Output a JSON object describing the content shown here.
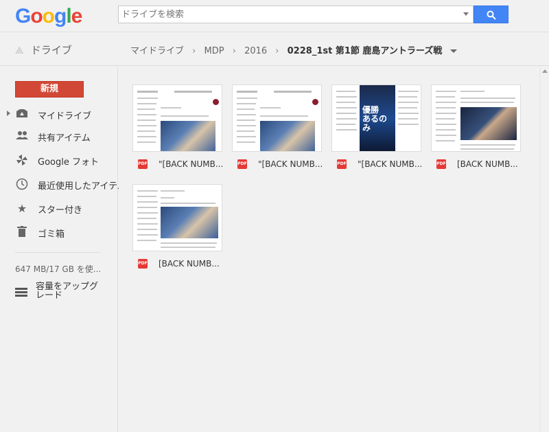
{
  "logo": {
    "letters": [
      {
        "ch": "G",
        "color": "#4285f4"
      },
      {
        "ch": "o",
        "color": "#ea4335"
      },
      {
        "ch": "o",
        "color": "#fbbc05"
      },
      {
        "ch": "g",
        "color": "#4285f4"
      },
      {
        "ch": "l",
        "color": "#34a853"
      },
      {
        "ch": "e",
        "color": "#ea4335"
      }
    ]
  },
  "search": {
    "placeholder": "ドライブを検索",
    "icon": "search-icon"
  },
  "app": {
    "title": "ドライブ",
    "icon": "drive-icon"
  },
  "breadcrumb": {
    "items": [
      "マイドライブ",
      "MDP",
      "2016"
    ],
    "current": "0228_1st 第1節 鹿島アントラーズ戦"
  },
  "sidebar": {
    "new_label": "新規",
    "items": [
      {
        "label": "マイドライブ",
        "icon": "my-drive-icon"
      },
      {
        "label": "共有アイテム",
        "icon": "shared-icon"
      },
      {
        "label": "Google フォト",
        "icon": "photos-icon"
      },
      {
        "label": "最近使用したアイテム",
        "icon": "recent-icon"
      },
      {
        "label": "スター付き",
        "icon": "star-icon"
      },
      {
        "label": "ゴミ箱",
        "icon": "trash-icon"
      }
    ],
    "storage": "647 MB/17 GB を使...",
    "upgrade": "容量をアップグレード"
  },
  "files": [
    {
      "name": "\"[BACK NUMB...",
      "type": "pdf",
      "pdf_label": "PDF"
    },
    {
      "name": "\"[BACK NUMB...",
      "type": "pdf",
      "pdf_label": "PDF"
    },
    {
      "name": "\"[BACK NUMB...",
      "type": "pdf",
      "pdf_label": "PDF",
      "poster_text": "優勝\nあるのみ"
    },
    {
      "name": "[BACK NUMB...",
      "type": "pdf",
      "pdf_label": "PDF"
    },
    {
      "name": "[BACK NUMB...",
      "type": "pdf",
      "pdf_label": "PDF"
    }
  ]
}
